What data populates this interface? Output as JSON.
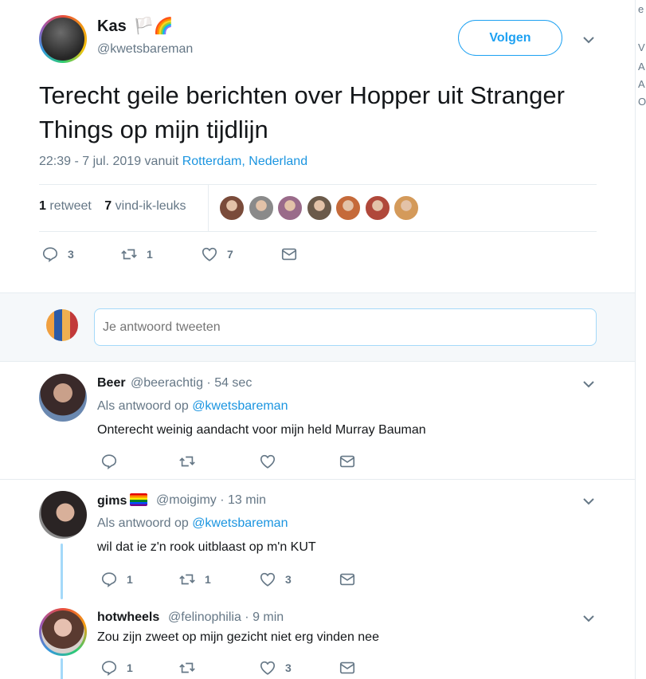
{
  "tweet": {
    "author_name": "Kas",
    "author_flags": "🏳️🌈",
    "author_handle": "@kwetsbareman",
    "follow_label": "Volgen",
    "text": "Terecht geile berichten over Hopper uit Stranger Things op mijn tijdlijn",
    "time_prefix": "22:39 - 7 jul. 2019 vanuit ",
    "location": "Rotterdam, Nederland",
    "retweets_count": "1",
    "retweets_label": "retweet",
    "likes_count": "7",
    "likes_label": "vind-ik-leuks",
    "action_counts": {
      "replies": "3",
      "retweets": "1",
      "likes": "7"
    },
    "liker_colors": [
      "#7a4b3a",
      "#8a8a8a",
      "#9a6b8a",
      "#6b5a4a",
      "#c56a3a",
      "#b0483a",
      "#d49a5a"
    ]
  },
  "reply_box": {
    "placeholder": "Je antwoord tweeten"
  },
  "replies": [
    {
      "name": "Beer",
      "handle": "@beerachtig",
      "time": "54 sec",
      "context_prefix": "Als antwoord op ",
      "context_handle": "@kwetsbareman",
      "text": "Onterecht weinig aandacht voor mijn held Murray Bauman",
      "counts": {
        "replies": "",
        "retweets": "",
        "likes": ""
      }
    },
    {
      "name": "gims",
      "handle": "@moigimy",
      "time": "13 min",
      "context_prefix": "Als antwoord op ",
      "context_handle": "@kwetsbareman",
      "text": "wil dat ie z'n rook uitblaast op m'n KUT",
      "counts": {
        "replies": "1",
        "retweets": "1",
        "likes": "3"
      }
    },
    {
      "name": "hotwheels",
      "handle": "@felinophilia",
      "time": "9 min",
      "text": "Zou zijn zweet op mijn gezicht niet erg vinden nee",
      "counts": {
        "replies": "1",
        "retweets": "",
        "likes": "3"
      }
    }
  ],
  "sidebar_letters": [
    "e",
    "V",
    "A",
    "A",
    "O"
  ],
  "colors": {
    "accent": "#1da1f2",
    "link": "#1b95e0",
    "muted": "#657786"
  }
}
